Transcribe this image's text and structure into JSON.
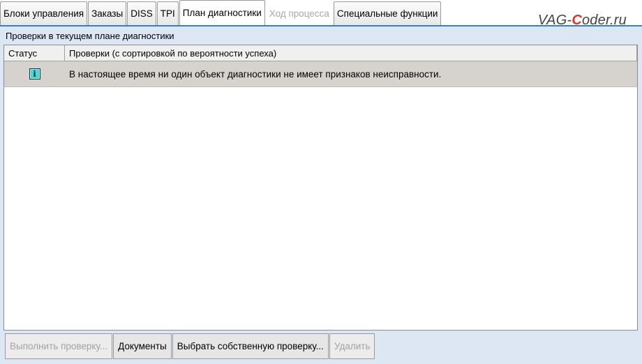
{
  "tabs": [
    {
      "label": "Блоки управления",
      "state": "normal"
    },
    {
      "label": "Заказы",
      "state": "normal"
    },
    {
      "label": "DISS",
      "state": "normal"
    },
    {
      "label": "TPI",
      "state": "normal"
    },
    {
      "label": "План диагностики",
      "state": "active"
    },
    {
      "label": "Ход процесса",
      "state": "disabled"
    },
    {
      "label": "Специальные функции",
      "state": "normal"
    }
  ],
  "watermark": {
    "part1": "VAG-",
    "part2": "C",
    "part3": "oder.ru"
  },
  "panel": {
    "title": "Проверки в текущем плане диагностики",
    "columns": {
      "status": "Статус",
      "checks": "Проверки (с сортировкой по вероятности успеха)"
    },
    "rows": [
      {
        "status_icon": "info-icon",
        "text": "В настоящее время ни один объект диагностики не имеет признаков неисправности."
      }
    ]
  },
  "buttons": {
    "run_check": "Выполнить проверку...",
    "documents": "Документы",
    "select_own_check": "Выбрать собственную проверку...",
    "delete": "Удалить"
  },
  "colors": {
    "accent_line": "#3d7bc4",
    "background": "#dde6f3",
    "row_highlight": "#d6d3cf",
    "info_icon": "#4fd6d0"
  }
}
